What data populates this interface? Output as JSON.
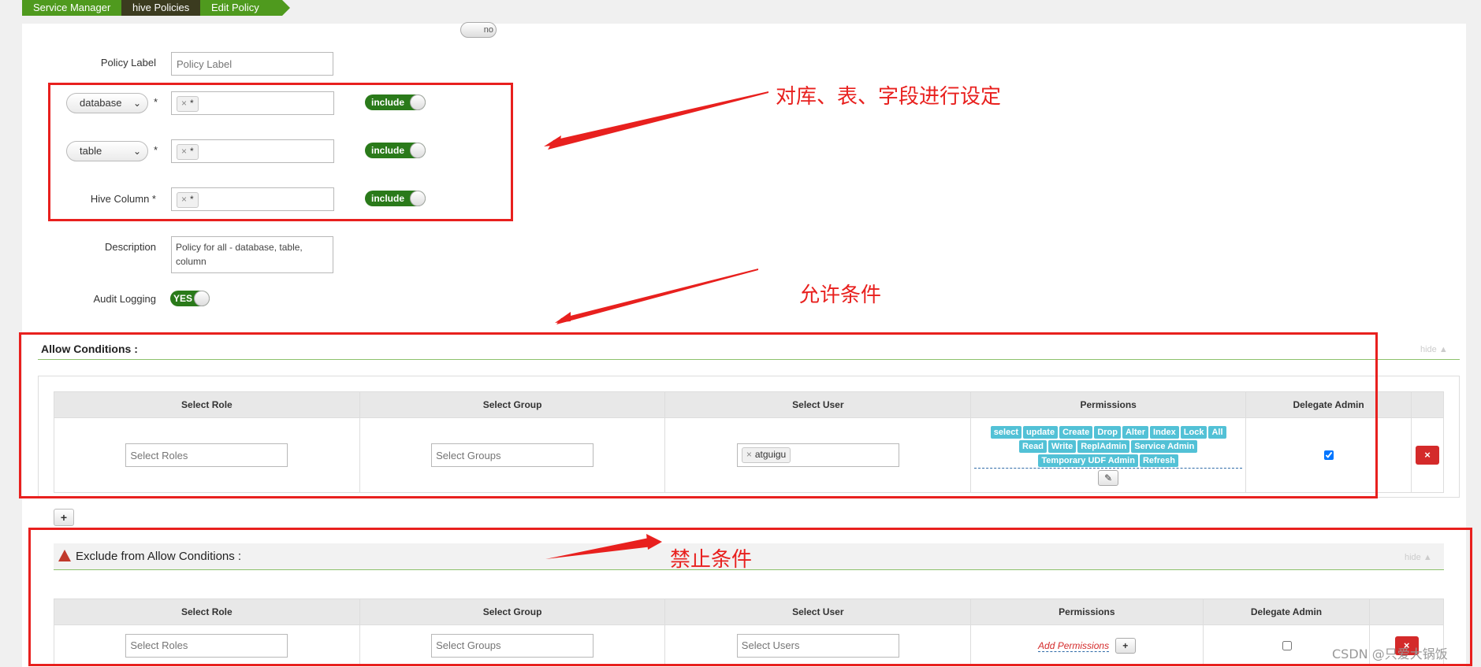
{
  "breadcrumb": [
    "Service Manager",
    "hive Policies",
    "Edit Policy"
  ],
  "top_toggle": "no",
  "form": {
    "policy_label_label": "Policy Label",
    "policy_label_placeholder": "Policy Label",
    "database_select": "database",
    "table_select": "table",
    "hive_column_label": "Hive Column *",
    "required_star": "*",
    "resource_value": "*",
    "include_label": "include",
    "description_label": "Description",
    "description_value": "Policy for all - database, table, column",
    "audit_label": "Audit Logging",
    "audit_value": "YES"
  },
  "annotations": {
    "resources": "对库、表、字段进行设定",
    "allow": "允许条件",
    "deny": "禁止条件"
  },
  "allow": {
    "title": "Allow Conditions :",
    "hide": "hide ▲",
    "headers": [
      "Select Role",
      "Select Group",
      "Select User",
      "Permissions",
      "Delegate Admin"
    ],
    "role_placeholder": "Select Roles",
    "group_placeholder": "Select Groups",
    "user_tag": "atguigu",
    "permissions": [
      "select",
      "update",
      "Create",
      "Drop",
      "Alter",
      "Index",
      "Lock",
      "All",
      "Read",
      "Write",
      "ReplAdmin",
      "Service Admin",
      "Temporary UDF Admin",
      "Refresh"
    ],
    "delegate_checked": true,
    "add_button": "+",
    "delete_button": "×"
  },
  "exclude": {
    "title": "Exclude from Allow Conditions :",
    "hide": "hide ▲",
    "headers": [
      "Select Role",
      "Select Group",
      "Select User",
      "Permissions",
      "Delegate Admin"
    ],
    "role_placeholder": "Select Roles",
    "group_placeholder": "Select Groups",
    "user_placeholder": "Select Users",
    "add_permissions": "Add Permissions",
    "add_button": "+",
    "delegate_checked": false
  },
  "watermark": "CSDN @只爱大锅饭",
  "colors": {
    "breadcrumb_green": "#4f9a1e",
    "toggle_green": "#2a7a1a",
    "annotation_red": "#e8201e",
    "permission_teal": "#52c1d6",
    "delete_red": "#d42a2a"
  }
}
